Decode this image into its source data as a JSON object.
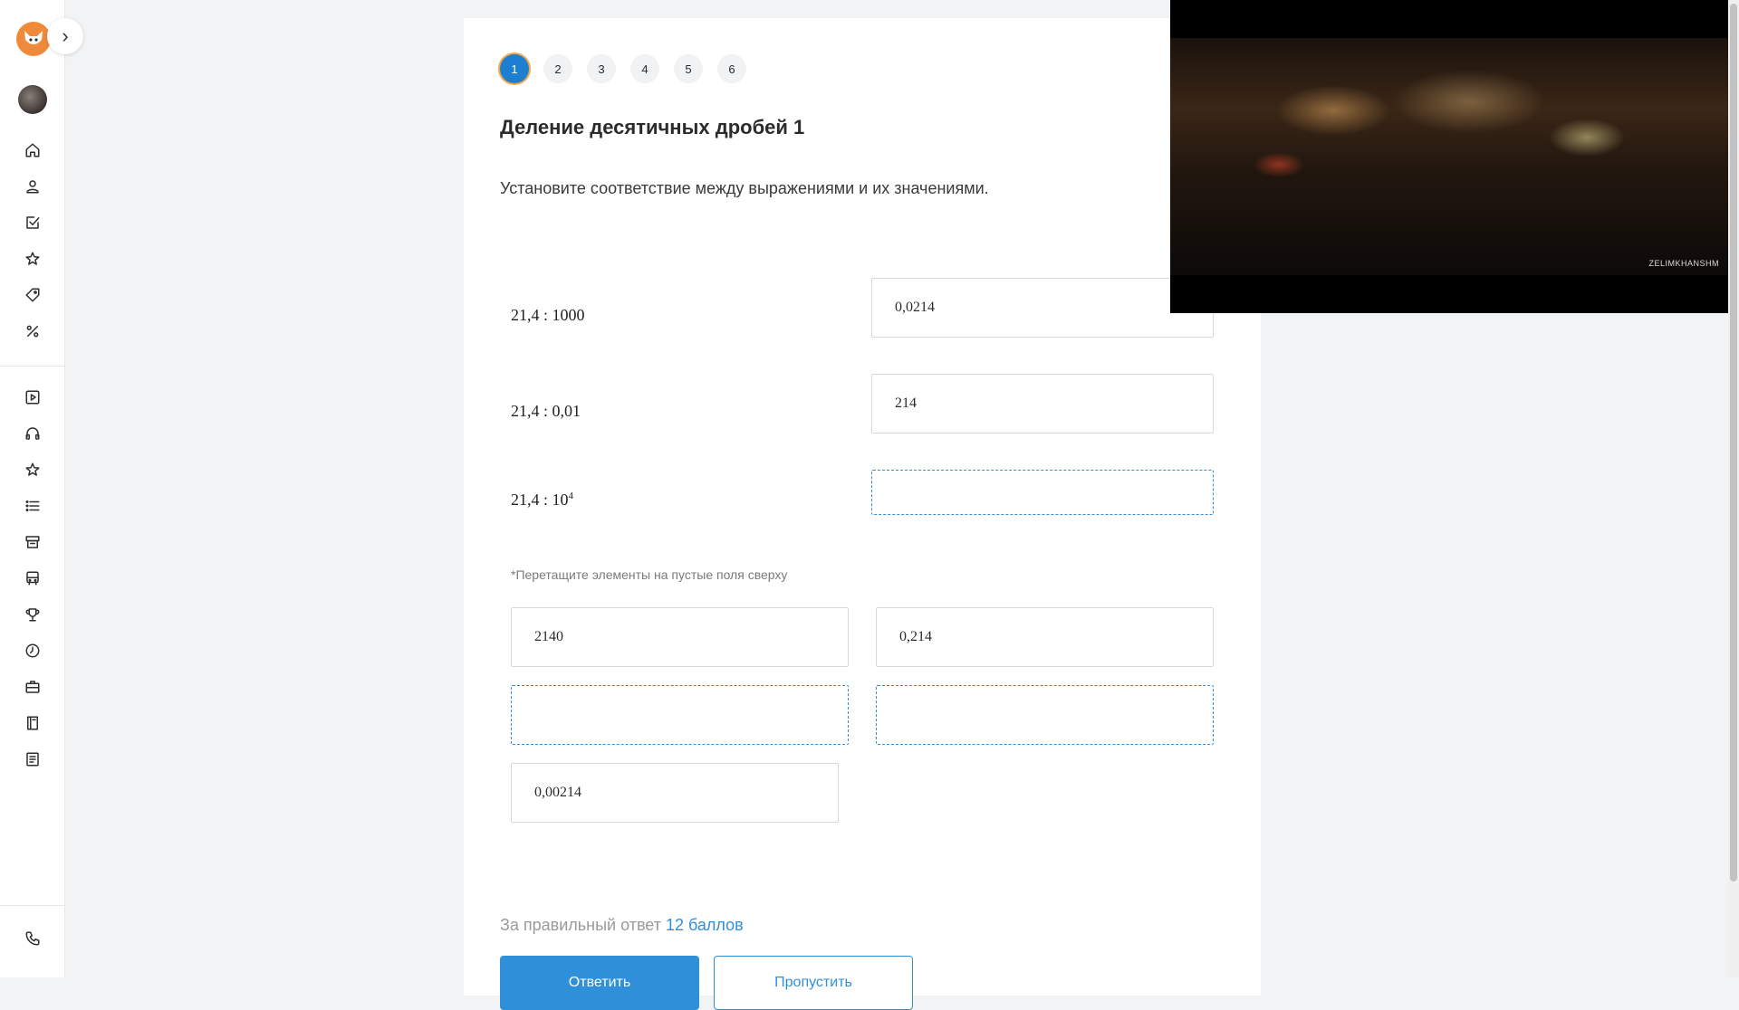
{
  "steps": [
    "1",
    "2",
    "3",
    "4",
    "5",
    "6"
  ],
  "active_step": "1",
  "task": {
    "title": "Деление десятичных дробей 1",
    "instruction": "Установите соответствие между выражениями и их значениями."
  },
  "rows": [
    {
      "expr_base": "21,4 : 1000",
      "expr_sup": "",
      "answer": "0,0214"
    },
    {
      "expr_base": "21,4 : 0,01",
      "expr_sup": "",
      "answer": "214"
    },
    {
      "expr_base": "21,4 : 10",
      "expr_sup": "4",
      "answer": ""
    }
  ],
  "hint": "*Перетащите элементы на пустые поля сверху",
  "tiles": [
    "2140",
    "0,214",
    "",
    "",
    "0,00214"
  ],
  "score": {
    "prefix": "За правильный ответ",
    "points": "12 баллов"
  },
  "buttons": {
    "primary": "Ответить",
    "secondary": "Пропустить"
  },
  "video": {
    "watermark": "ZELIMKHANSHM"
  },
  "colors": {
    "accent": "#2f8fd8",
    "step_active": "#1d7fd1",
    "step_ring": "#f4a640"
  }
}
